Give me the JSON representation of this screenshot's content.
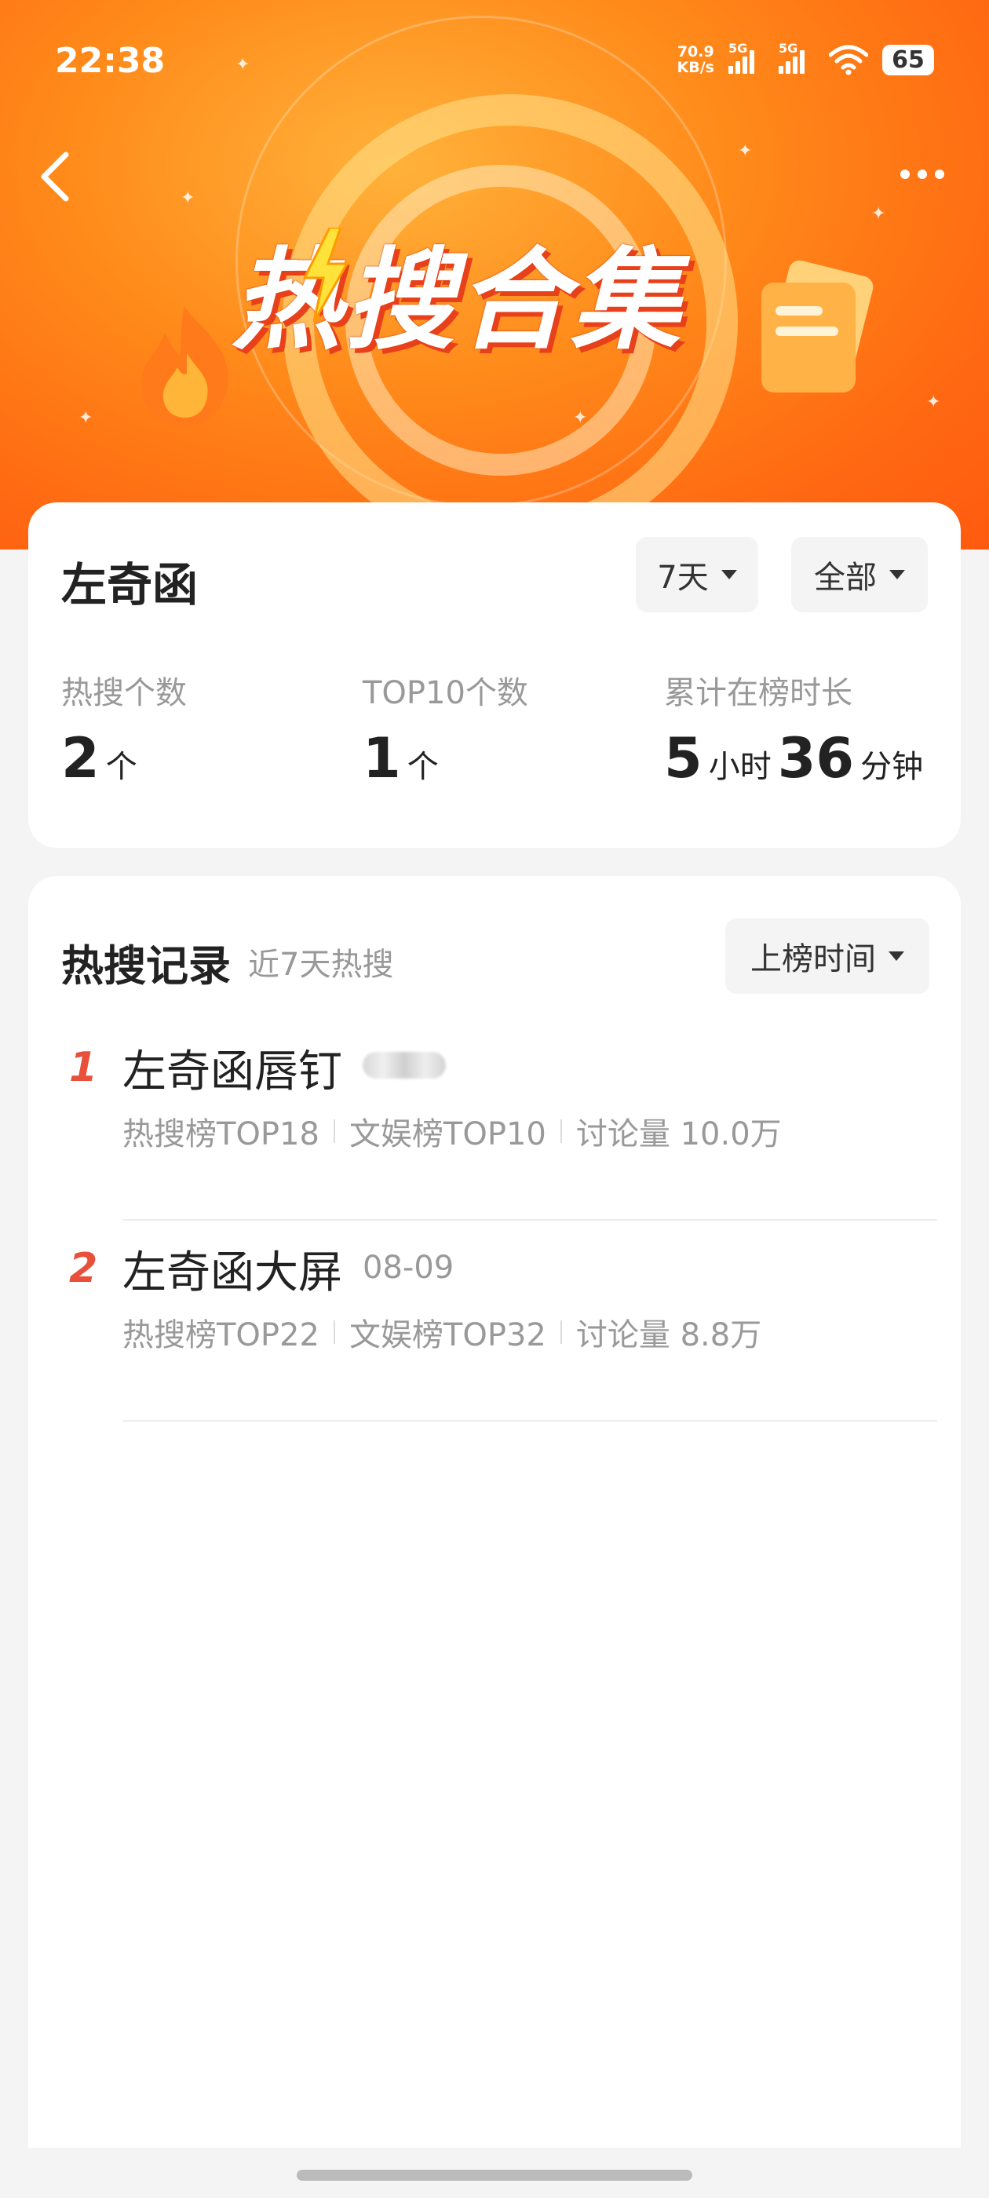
{
  "status_bar": {
    "time": "22:38",
    "net_speed_value": "70.9",
    "net_speed_unit": "KB/s",
    "sim1_label": "5G",
    "sim2_label": "5G",
    "battery": "65"
  },
  "hero": {
    "title": "热搜合集"
  },
  "profile": {
    "name": "左奇函",
    "filter_period": "7天",
    "filter_scope": "全部",
    "stats": [
      {
        "label": "热搜个数",
        "value": "2",
        "unit": "个"
      },
      {
        "label": "TOP10个数",
        "value": "1",
        "unit": "个"
      },
      {
        "label": "累计在榜时长",
        "hours": "5",
        "hours_unit": "小时",
        "minutes": "36",
        "minutes_unit": "分钟"
      }
    ]
  },
  "records": {
    "title": "热搜记录",
    "subtitle": "近7天热搜",
    "sort_label": "上榜时间",
    "items": [
      {
        "rank": "1",
        "title": "左奇函唇钉",
        "date": "",
        "hot_rank": "热搜榜TOP18",
        "ent_rank": "文娱榜TOP10",
        "discussion": "讨论量 10.0万"
      },
      {
        "rank": "2",
        "title": "左奇函大屏",
        "date": "08-09",
        "hot_rank": "热搜榜TOP22",
        "ent_rank": "文娱榜TOP32",
        "discussion": "讨论量 8.8万"
      }
    ]
  },
  "colors": {
    "hero_orange": "#ff6a12",
    "rank_red": "#e8503c",
    "muted_text": "#999999"
  }
}
